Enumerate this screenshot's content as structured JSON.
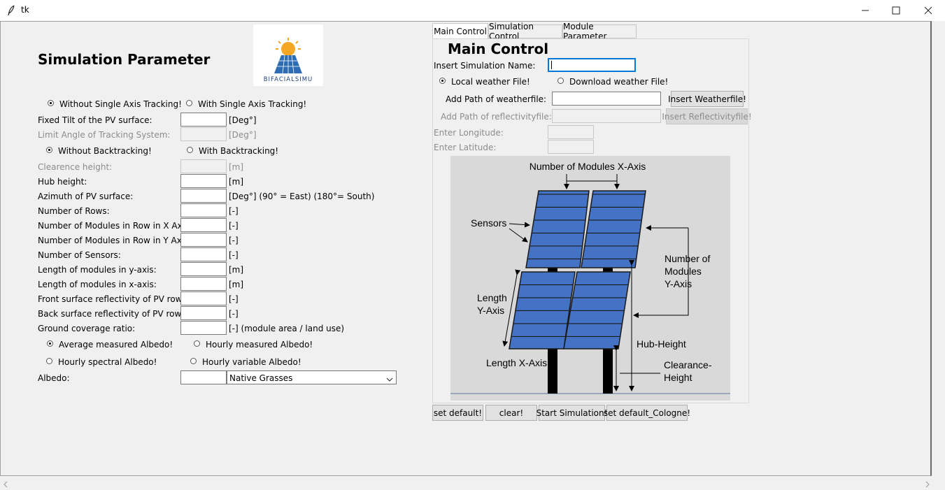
{
  "window": {
    "title": "tk"
  },
  "left": {
    "heading": "Simulation Parameter",
    "logo_text": "BIFACIALSIMU",
    "tracking": {
      "opt1": "Without Single Axis Tracking!",
      "opt2": "With Single Axis Tracking!",
      "selected": 1
    },
    "backtracking": {
      "opt1": "Without Backtracking!",
      "opt2": "With Backtracking!",
      "selected": 1
    },
    "fields": [
      {
        "label": "Fixed Tilt of the PV surface:",
        "unit": "[Deg°]",
        "value": "",
        "disabled": false
      },
      {
        "label": "Limit Angle of Tracking System:",
        "unit": "[Deg°]",
        "value": "",
        "disabled": true
      },
      {
        "label": "Clearence height:",
        "unit": "[m]",
        "value": "",
        "disabled": true
      },
      {
        "label": "Hub height:",
        "unit": "[m]",
        "value": "",
        "disabled": false
      },
      {
        "label": "Azimuth of PV surface:",
        "unit": "[Deg°] (90° = East) (180°= South)",
        "value": "",
        "disabled": false
      },
      {
        "label": "Number of Rows:",
        "unit": "[-]",
        "value": "",
        "disabled": false
      },
      {
        "label": "Number of Modules in Row in X Axis:",
        "unit": "[-]",
        "value": "",
        "disabled": false
      },
      {
        "label": "Number of Modules in Row in Y Axis:",
        "unit": "[-]",
        "value": "",
        "disabled": false
      },
      {
        "label": "Number of Sensors:",
        "unit": "[-]",
        "value": "",
        "disabled": false
      },
      {
        "label": "Length of modules in y-axis:",
        "unit": "[m]",
        "value": "",
        "disabled": false
      },
      {
        "label": "Length of modules in x-axis:",
        "unit": "[m]",
        "value": "",
        "disabled": false
      },
      {
        "label": "Front surface reflectivity of PV rows:",
        "unit": "[-]",
        "value": "",
        "disabled": false
      },
      {
        "label": "Back surface reflectivity of PV rows:",
        "unit": "[-]",
        "value": "",
        "disabled": false
      },
      {
        "label": "Ground coverage ratio:",
        "unit": "[-] (module area / land use)",
        "value": "",
        "disabled": false
      }
    ],
    "albedo_modes": {
      "opt1": "Average measured Albedo!",
      "opt2": "Hourly measured Albedo!",
      "opt3": "Hourly spectral Albedo!",
      "opt4": "Hourly variable Albedo!",
      "selected": 1
    },
    "albedo": {
      "label": "Albedo:",
      "value": "",
      "selected": "Native Grasses"
    }
  },
  "tabs": [
    {
      "label": "Main Control",
      "active": true
    },
    {
      "label": "Simulation Control",
      "active": false
    },
    {
      "label": "Module Parameter",
      "active": false
    }
  ],
  "main": {
    "heading": "Main Control",
    "sim_name_label": "Insert Simulation Name:",
    "sim_name_value": "",
    "weather": {
      "opt1": "Local weather File!",
      "opt2": "Download weather File!",
      "selected": 1
    },
    "weather_path_label": "Add Path of weatherfile:",
    "weather_button": "Insert Weatherfile!",
    "refl_path_label": "Add Path of reflectivityfile:",
    "refl_button": "Insert Reflectivityfile!",
    "lon_label": "Enter Longitude:",
    "lat_label": "Enter Latitude:",
    "diagram": {
      "top": "Number of Modules X-Axis",
      "sensors": "Sensors",
      "ny1": "Number of",
      "ny2": "Modules",
      "ny3": "Y-Axis",
      "ly1": "Length",
      "ly2": "Y-Axis",
      "hub": "Hub-Height",
      "lx": "Length X-Axis",
      "cl1": "Clearance-",
      "cl2": "Height",
      "panel_color": "#4472c4"
    }
  },
  "buttons": {
    "set_default": "set default!",
    "clear": "clear!",
    "start": "Start Simulation!",
    "cologne": "set default_Cologne!"
  }
}
